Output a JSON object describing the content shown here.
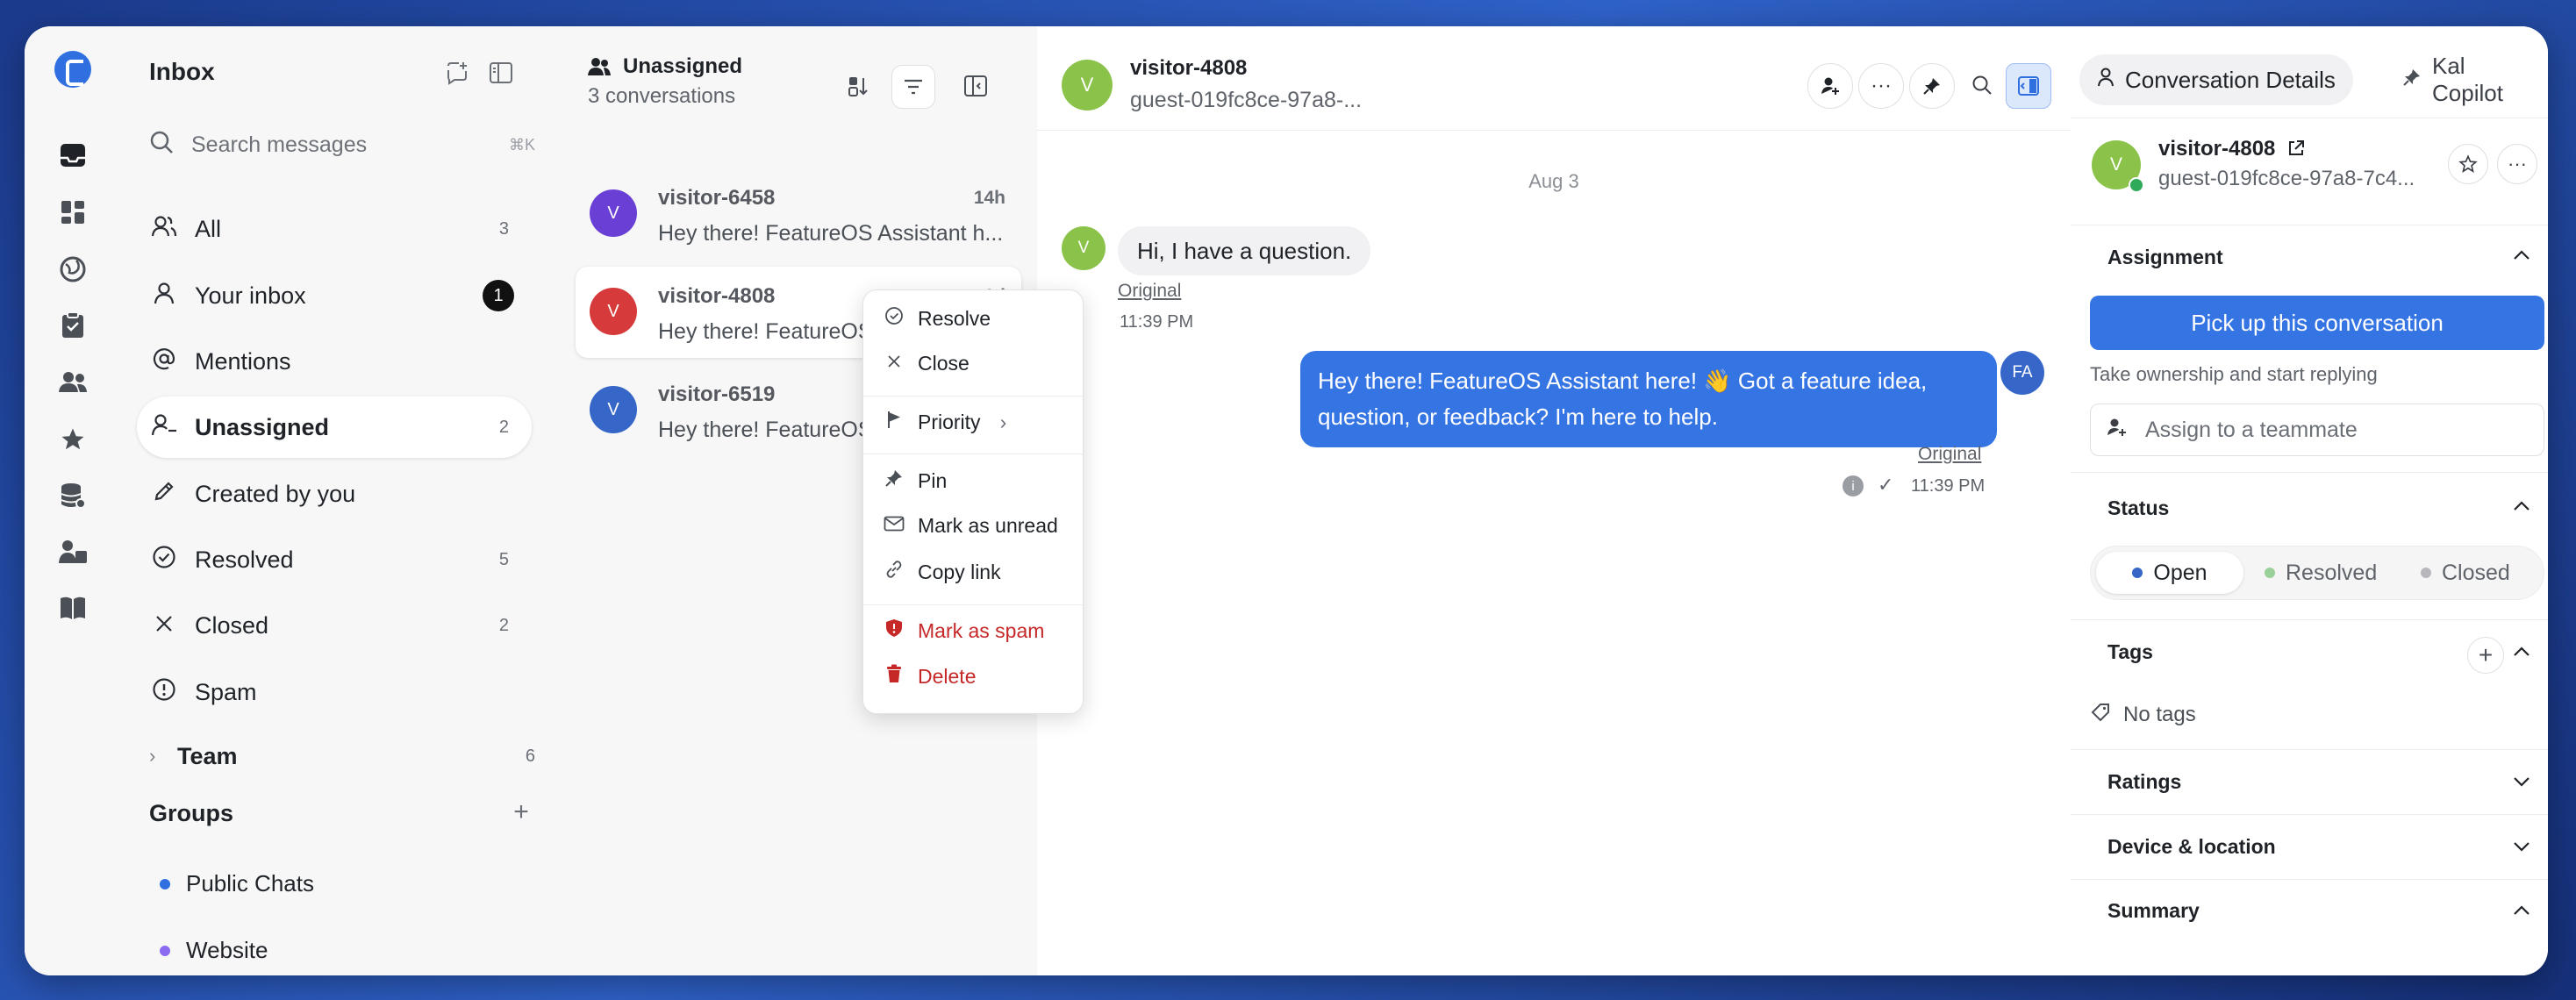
{
  "rail": {
    "icons": [
      "logo-icon",
      "inbox-icon",
      "dashboard-icon",
      "globe-icon",
      "clipboard-icon",
      "users-icon",
      "star-icon",
      "database-icon",
      "team-icon",
      "book-icon"
    ]
  },
  "sidebar": {
    "title": "Inbox",
    "search_placeholder": "Search messages",
    "search_shortcut": "⌘K",
    "items": [
      {
        "label": "All",
        "count": "3"
      },
      {
        "label": "Your inbox",
        "badge": "1"
      },
      {
        "label": "Mentions",
        "count": ""
      },
      {
        "label": "Unassigned",
        "count": "2"
      },
      {
        "label": "Created by you",
        "count": ""
      },
      {
        "label": "Resolved",
        "count": "5"
      },
      {
        "label": "Closed",
        "count": "2"
      },
      {
        "label": "Spam",
        "count": ""
      }
    ],
    "team": {
      "label": "Team",
      "count": "6"
    },
    "groups_title": "Groups",
    "groups": [
      {
        "label": "Public Chats",
        "color": "#2f6fe0"
      },
      {
        "label": "Website",
        "color": "#8b6cf0"
      }
    ]
  },
  "convlist": {
    "title": "Unassigned",
    "subtitle": "3 conversations",
    "items": [
      {
        "initial": "V",
        "name": "visitor-6458",
        "time": "14h",
        "preview": "Hey there! FeatureOS Assistant h...",
        "color": "#6a3fd6"
      },
      {
        "initial": "V",
        "name": "visitor-4808",
        "time": "1d",
        "preview": "Hey there! FeatureOS Assistant here!",
        "color": "#d63a3a"
      },
      {
        "initial": "V",
        "name": "visitor-6519",
        "time": "",
        "preview": "Hey there! FeatureOS Assistant here!",
        "color": "#3566c8"
      }
    ]
  },
  "context_menu": {
    "resolve": "Resolve",
    "close": "Close",
    "priority": "Priority",
    "pin": "Pin",
    "mark_unread": "Mark as unread",
    "copy_link": "Copy link",
    "mark_spam": "Mark as spam",
    "delete": "Delete"
  },
  "chat": {
    "initial": "V",
    "name": "visitor-4808",
    "subtitle": "guest-019fc8ce-97a8-...",
    "date": "Aug 3",
    "messages": [
      {
        "text": "Hi, I have a question.",
        "original": "Original",
        "time": "11:39 PM"
      },
      {
        "avatar": "FA",
        "text": "Hey there! FeatureOS Assistant here! 👋 Got a feature idea, question, or feedback? I'm here to help.",
        "original": "Original",
        "time": "11:39 PM"
      }
    ]
  },
  "details": {
    "tab_details": "Conversation Details",
    "tab_copilot": "Kal Copilot",
    "initial": "V",
    "name": "visitor-4808",
    "subtitle": "guest-019fc8ce-97a8-7c4...",
    "assignment_title": "Assignment",
    "pickup_label": "Pick up this conversation",
    "pickup_hint": "Take ownership and start replying",
    "assign_placeholder": "Assign to a teammate",
    "status_title": "Status",
    "status_options": [
      "Open",
      "Resolved",
      "Closed"
    ],
    "status_selected": "Open",
    "tags_title": "Tags",
    "no_tags": "No tags",
    "ratings_title": "Ratings",
    "device_title": "Device & location",
    "summary_title": "Summary"
  },
  "colors": {
    "accent": "#3574e3",
    "open_dot": "#3566c8",
    "resolved_dot": "#9ad09a",
    "closed_dot": "#b8b8bc",
    "danger": "#c62828"
  }
}
